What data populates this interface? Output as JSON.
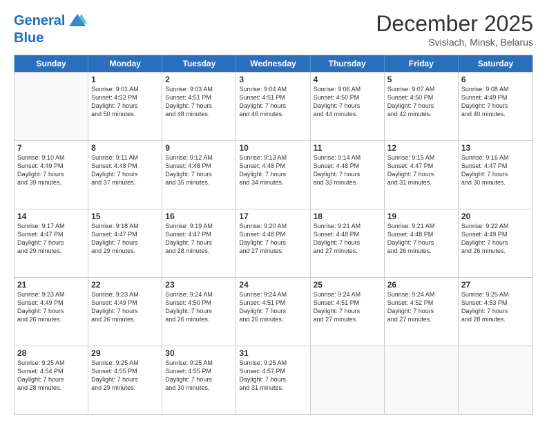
{
  "header": {
    "logo_line1": "General",
    "logo_line2": "Blue",
    "month_title": "December 2025",
    "location": "Svislach, Minsk, Belarus"
  },
  "days_of_week": [
    "Sunday",
    "Monday",
    "Tuesday",
    "Wednesday",
    "Thursday",
    "Friday",
    "Saturday"
  ],
  "weeks": [
    [
      {
        "day": "",
        "info": ""
      },
      {
        "day": "1",
        "info": "Sunrise: 9:01 AM\nSunset: 4:52 PM\nDaylight: 7 hours\nand 50 minutes."
      },
      {
        "day": "2",
        "info": "Sunrise: 9:03 AM\nSunset: 4:51 PM\nDaylight: 7 hours\nand 48 minutes."
      },
      {
        "day": "3",
        "info": "Sunrise: 9:04 AM\nSunset: 4:51 PM\nDaylight: 7 hours\nand 46 minutes."
      },
      {
        "day": "4",
        "info": "Sunrise: 9:06 AM\nSunset: 4:50 PM\nDaylight: 7 hours\nand 44 minutes."
      },
      {
        "day": "5",
        "info": "Sunrise: 9:07 AM\nSunset: 4:50 PM\nDaylight: 7 hours\nand 42 minutes."
      },
      {
        "day": "6",
        "info": "Sunrise: 9:08 AM\nSunset: 4:49 PM\nDaylight: 7 hours\nand 40 minutes."
      }
    ],
    [
      {
        "day": "7",
        "info": "Sunrise: 9:10 AM\nSunset: 4:49 PM\nDaylight: 7 hours\nand 39 minutes."
      },
      {
        "day": "8",
        "info": "Sunrise: 9:11 AM\nSunset: 4:48 PM\nDaylight: 7 hours\nand 37 minutes."
      },
      {
        "day": "9",
        "info": "Sunrise: 9:12 AM\nSunset: 4:48 PM\nDaylight: 7 hours\nand 35 minutes."
      },
      {
        "day": "10",
        "info": "Sunrise: 9:13 AM\nSunset: 4:48 PM\nDaylight: 7 hours\nand 34 minutes."
      },
      {
        "day": "11",
        "info": "Sunrise: 9:14 AM\nSunset: 4:48 PM\nDaylight: 7 hours\nand 33 minutes."
      },
      {
        "day": "12",
        "info": "Sunrise: 9:15 AM\nSunset: 4:47 PM\nDaylight: 7 hours\nand 31 minutes."
      },
      {
        "day": "13",
        "info": "Sunrise: 9:16 AM\nSunset: 4:47 PM\nDaylight: 7 hours\nand 30 minutes."
      }
    ],
    [
      {
        "day": "14",
        "info": "Sunrise: 9:17 AM\nSunset: 4:47 PM\nDaylight: 7 hours\nand 29 minutes."
      },
      {
        "day": "15",
        "info": "Sunrise: 9:18 AM\nSunset: 4:47 PM\nDaylight: 7 hours\nand 29 minutes."
      },
      {
        "day": "16",
        "info": "Sunrise: 9:19 AM\nSunset: 4:47 PM\nDaylight: 7 hours\nand 28 minutes."
      },
      {
        "day": "17",
        "info": "Sunrise: 9:20 AM\nSunset: 4:48 PM\nDaylight: 7 hours\nand 27 minutes."
      },
      {
        "day": "18",
        "info": "Sunrise: 9:21 AM\nSunset: 4:48 PM\nDaylight: 7 hours\nand 27 minutes."
      },
      {
        "day": "19",
        "info": "Sunrise: 9:21 AM\nSunset: 4:48 PM\nDaylight: 7 hours\nand 26 minutes."
      },
      {
        "day": "20",
        "info": "Sunrise: 9:22 AM\nSunset: 4:49 PM\nDaylight: 7 hours\nand 26 minutes."
      }
    ],
    [
      {
        "day": "21",
        "info": "Sunrise: 9:23 AM\nSunset: 4:49 PM\nDaylight: 7 hours\nand 26 minutes."
      },
      {
        "day": "22",
        "info": "Sunrise: 9:23 AM\nSunset: 4:49 PM\nDaylight: 7 hours\nand 26 minutes."
      },
      {
        "day": "23",
        "info": "Sunrise: 9:24 AM\nSunset: 4:50 PM\nDaylight: 7 hours\nand 26 minutes."
      },
      {
        "day": "24",
        "info": "Sunrise: 9:24 AM\nSunset: 4:51 PM\nDaylight: 7 hours\nand 26 minutes."
      },
      {
        "day": "25",
        "info": "Sunrise: 9:24 AM\nSunset: 4:51 PM\nDaylight: 7 hours\nand 27 minutes."
      },
      {
        "day": "26",
        "info": "Sunrise: 9:24 AM\nSunset: 4:52 PM\nDaylight: 7 hours\nand 27 minutes."
      },
      {
        "day": "27",
        "info": "Sunrise: 9:25 AM\nSunset: 4:53 PM\nDaylight: 7 hours\nand 28 minutes."
      }
    ],
    [
      {
        "day": "28",
        "info": "Sunrise: 9:25 AM\nSunset: 4:54 PM\nDaylight: 7 hours\nand 28 minutes."
      },
      {
        "day": "29",
        "info": "Sunrise: 9:25 AM\nSunset: 4:55 PM\nDaylight: 7 hours\nand 29 minutes."
      },
      {
        "day": "30",
        "info": "Sunrise: 9:25 AM\nSunset: 4:55 PM\nDaylight: 7 hours\nand 30 minutes."
      },
      {
        "day": "31",
        "info": "Sunrise: 9:25 AM\nSunset: 4:57 PM\nDaylight: 7 hours\nand 31 minutes."
      },
      {
        "day": "",
        "info": ""
      },
      {
        "day": "",
        "info": ""
      },
      {
        "day": "",
        "info": ""
      }
    ]
  ]
}
